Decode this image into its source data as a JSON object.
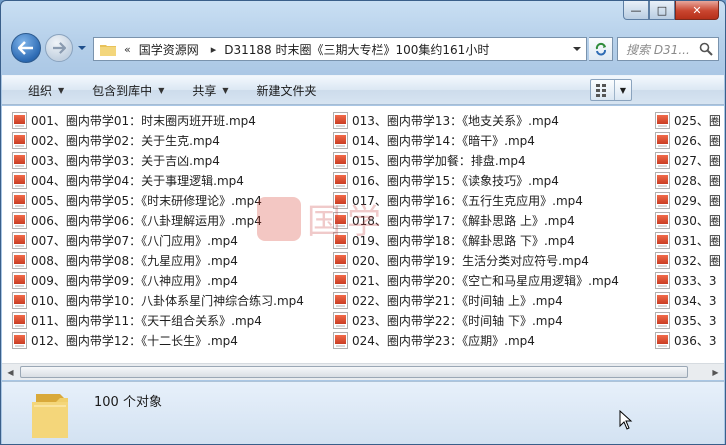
{
  "window": {
    "caption_buttons": {
      "minimize": "—",
      "maximize": "□",
      "close": "✕"
    }
  },
  "address": {
    "overflow": "«",
    "crumbs": [
      "国学资源网",
      "D31188 时末圈《三期大专栏》100集约161小时"
    ]
  },
  "search": {
    "placeholder": "搜索 D31..."
  },
  "toolbar": {
    "organize": "组织",
    "include": "包含到库中",
    "share": "共享",
    "new_folder": "新建文件夹"
  },
  "columns": [
    [
      "001、圈内带学01：时末圈丙班开班.mp4",
      "002、圈内带学02：关于生克.mp4",
      "003、圈内带学03：关于吉凶.mp4",
      "004、圈内带学04：关于事理逻辑.mp4",
      "005、圈内带学05：《时末研修理论》.mp4",
      "006、圈内带学06：《八卦理解运用》.mp4",
      "007、圈内带学07：《八门应用》.mp4",
      "008、圈内带学08：《九星应用》.mp4",
      "009、圈内带学09：《八神应用》.mp4",
      "010、圈内带学10：八卦体系星门神综合练习.mp4",
      "011、圈内带学11：《天干组合关系》.mp4",
      "012、圈内带学12：《十二长生》.mp4"
    ],
    [
      "013、圈内带学13：《地支关系》.mp4",
      "014、圈内带学14：《暗干》.mp4",
      "015、圈内带学加餐：排盘.mp4",
      "016、圈内带学15：《读象技巧》.mp4",
      "017、圈内带学16：《五行生克应用》.mp4",
      "018、圈内带学17：《解卦思路 上》.mp4",
      "019、圈内带学18：《解卦思路 下》.mp4",
      "020、圈内带学19：生活分类对应符号.mp4",
      "021、圈内带学20：《空亡和马星应用逻辑》.mp4",
      "022、圈内带学21：《时间轴 上》.mp4",
      "023、圈内带学22：《时间轴 下》.mp4",
      "024、圈内带学23：《应期》.mp4"
    ],
    [
      "025、圈",
      "026、圈",
      "027、圈",
      "028、圈",
      "029、圈",
      "030、圈",
      "031、圈",
      "032、圈",
      "033、3",
      "034、3",
      "035、3",
      "036、3"
    ]
  ],
  "watermark": {
    "text": "国学"
  },
  "details": {
    "count_text": "100 个对象"
  },
  "colors": {
    "accent": "#2d6bb4",
    "close": "#c9452f"
  }
}
